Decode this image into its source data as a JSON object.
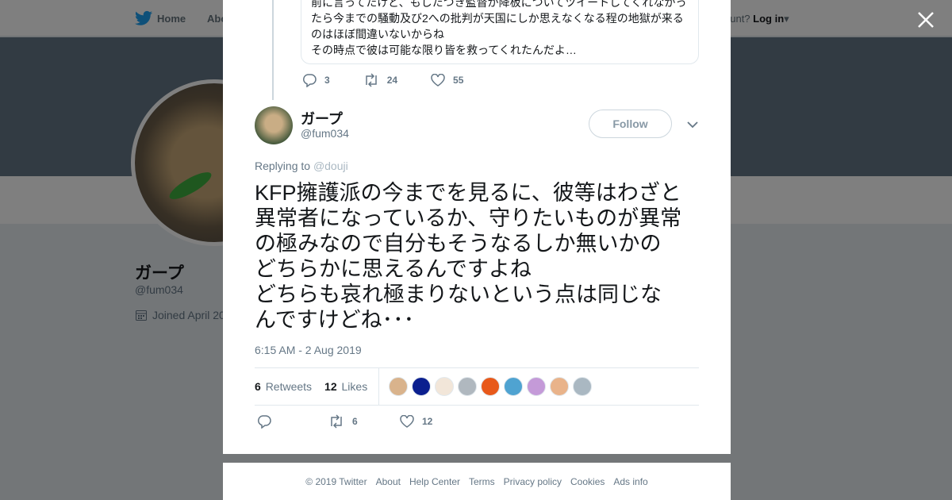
{
  "nav": {
    "home": "Home",
    "about": "Abo",
    "account_text": "ccount?",
    "login": "Log in"
  },
  "profile": {
    "name": "ガープ",
    "handle": "@fum034",
    "joined": "Joined April 20"
  },
  "previous_tweet": {
    "lines": [
      "前に言ってたけど、もしたつき監督が降板についてツイートしてくれなかっ",
      "たら今までの騒動及び2への批判が天国にしか思えなくなる程の地獄が来る",
      "のはほぼ間違いないからね",
      "その時点で彼は可能な限り皆を救ってくれたんだよ…"
    ],
    "replies": "3",
    "retweets": "24",
    "likes": "55"
  },
  "tweet": {
    "author_name": "ガープ",
    "author_handle": "@fum034",
    "follow_label": "Follow",
    "replying_label": "Replying to",
    "replying_handle": "@douji",
    "text": "KFP擁護派の今までを見るに、彼等はわざと\n異常者になっているか、守りたいものが異常\nの極みなので自分もそうなるしか無いかの\nどちらかに思えるんですよね\nどちらも哀れ極まりないという点は同じな\nんですけどね･･･",
    "timestamp": "6:15 AM - 2 Aug 2019",
    "retweets_count": "6",
    "retweets_label": "Retweets",
    "likes_count": "12",
    "likes_label": "Likes",
    "action_retweets": "6",
    "action_likes": "12"
  },
  "likers": [
    "#d9b38c",
    "#0b1f8f",
    "#f2e6d9",
    "#b0b8bf",
    "#e8591a",
    "#4fa3d1",
    "#c49ad8",
    "#e9b38a",
    "#aab8c2"
  ],
  "footer": [
    "© 2019 Twitter",
    "About",
    "Help Center",
    "Terms",
    "Privacy policy",
    "Cookies",
    "Ads info"
  ],
  "colors": {
    "twitter_blue": "#1da1f2",
    "text_secondary": "#657786"
  },
  "icons": [
    "twitter-bird-icon",
    "close-icon",
    "reply-icon",
    "retweet-icon",
    "like-icon",
    "calendar-icon",
    "chevron-down-icon"
  ]
}
